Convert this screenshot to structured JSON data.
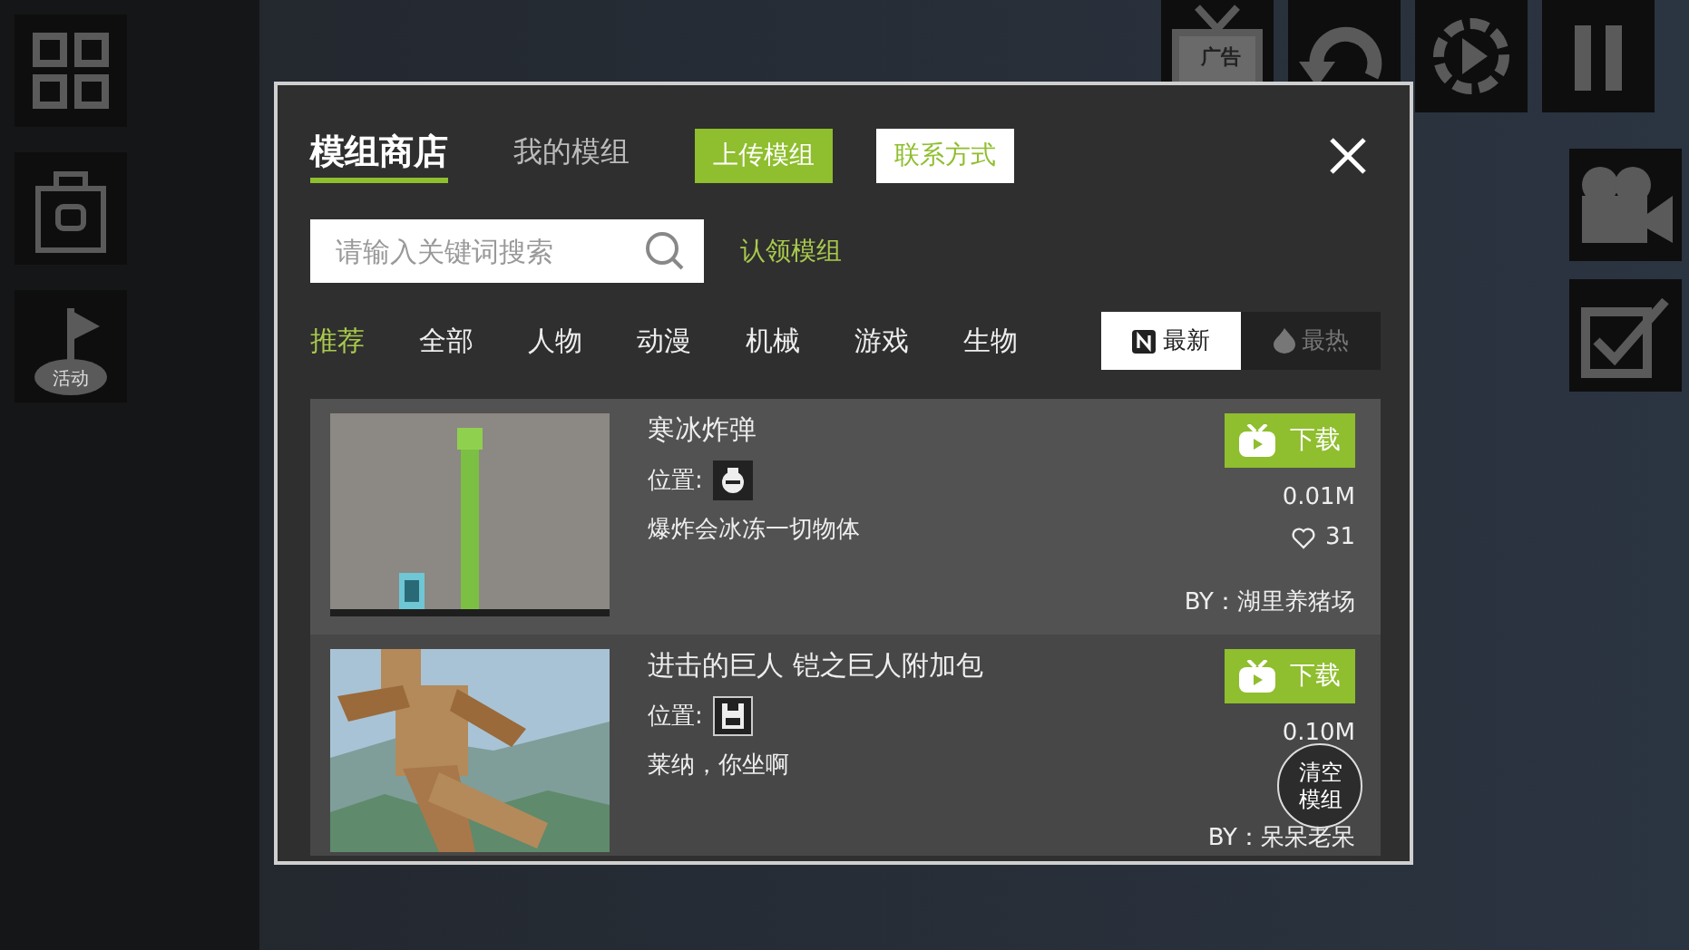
{
  "left_tools": [
    {
      "kind": "grid"
    },
    {
      "kind": "bag"
    },
    {
      "kind": "flag",
      "label": "活动"
    }
  ],
  "top_tools": [
    {
      "kind": "tv",
      "label": "广告"
    },
    {
      "kind": "undo"
    },
    {
      "kind": "slowmo"
    },
    {
      "kind": "pause"
    }
  ],
  "right_tools": [
    {
      "kind": "camera"
    },
    {
      "kind": "check"
    }
  ],
  "dialog": {
    "tabs": [
      {
        "label": "模组商店",
        "selected": true
      },
      {
        "label": "我的模组",
        "selected": false
      }
    ],
    "upload_button": "上传模组",
    "contact_button": "联系方式",
    "search": {
      "placeholder": "请输入关键词搜索"
    },
    "claim_link": "认领模组",
    "categories": [
      {
        "label": "推荐",
        "selected": true
      },
      {
        "label": "全部",
        "selected": false
      },
      {
        "label": "人物",
        "selected": false
      },
      {
        "label": "动漫",
        "selected": false
      },
      {
        "label": "机械",
        "selected": false
      },
      {
        "label": "游戏",
        "selected": false
      },
      {
        "label": "生物",
        "selected": false
      }
    ],
    "sort": [
      {
        "kind": "new",
        "label": "最新",
        "selected": true
      },
      {
        "kind": "hot",
        "label": "最热",
        "selected": false
      }
    ],
    "items": [
      {
        "title": "寒冰炸弹",
        "location_label": "位置:",
        "location_icon": {
          "kind": "bomb"
        },
        "description": "爆炸会冰冻一切物体",
        "download": "下载",
        "size": "0.01M",
        "likes": "31",
        "author": "BY：湖里养猪场"
      },
      {
        "title": "进击的巨人 铠之巨人附加包",
        "location_label": "位置:",
        "location_icon": {
          "kind": "disk"
        },
        "description": "莱纳，你坐啊",
        "download": "下载",
        "size": "0.10M",
        "author": "BY：呆呆老呆"
      }
    ],
    "clear_button": "清空模组"
  }
}
